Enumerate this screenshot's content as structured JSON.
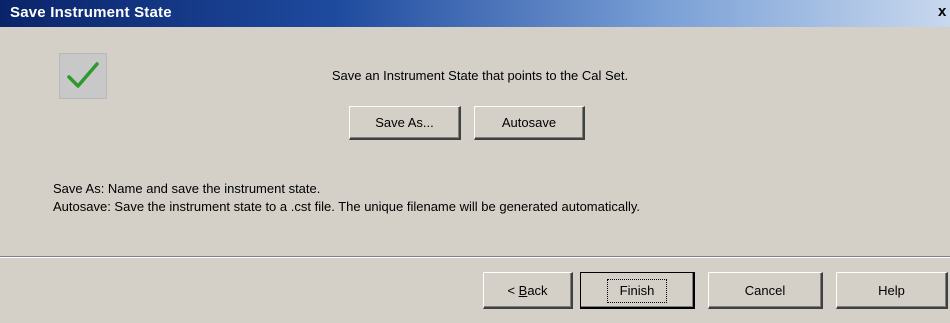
{
  "window": {
    "title": "Save Instrument State",
    "close_glyph": "x"
  },
  "icon": {
    "name": "checkmark-icon",
    "color": "#2e9a2e"
  },
  "main": {
    "heading": "Save an Instrument State that points to the Cal Set.",
    "buttons": {
      "save_as": "Save As...",
      "autosave": "Autosave"
    },
    "descriptions": [
      "Save As:  Name and save the instrument state.",
      "Autosave:  Save the instrument state to a .cst file.  The unique filename will be generated automatically."
    ]
  },
  "footer": {
    "back_prefix": "< ",
    "back_mnemonic": "B",
    "back_rest": "ack",
    "finish": "Finish",
    "cancel": "Cancel",
    "help": "Help"
  }
}
